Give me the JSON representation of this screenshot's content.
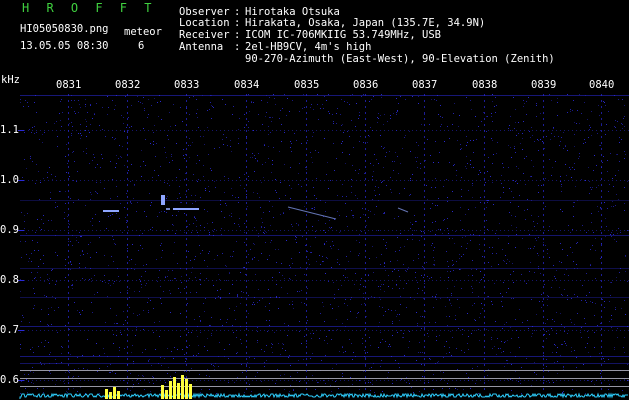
{
  "header": {
    "app_title": "H R O F F T",
    "file_name": "HI05050830.png",
    "mode_label": "meteor",
    "datetime": "13.05.05 08:30",
    "count": "6",
    "observer_label": "Observer",
    "observer": "Hirotaka Otsuka",
    "location_label": "Location",
    "location": "Hirakata, Osaka, Japan (135.7E, 34.9N)",
    "receiver_label": "Receiver",
    "receiver": "ICOM IC-706MKIIG 53.749MHz, USB",
    "antenna_label": "Antenna",
    "antenna": "2el-HB9CV, 4m's high",
    "antenna_line2": "90-270-Azimuth (East-West), 90-Elevation (Zenith)"
  },
  "axes": {
    "y_unit": "kHz",
    "x_ticks": [
      "0831",
      "0832",
      "0833",
      "0834",
      "0835",
      "0836",
      "0837",
      "0838",
      "0839",
      "0840"
    ],
    "y_ticks": [
      "1.1",
      "1.0",
      "0.9",
      "0.8",
      "0.7",
      "0.6"
    ]
  },
  "colors": {
    "background": "#000000",
    "title_green": "#3fd03f",
    "noise_blue": "#2a2ad8",
    "echo_blue": "#8fa6ff",
    "baseline_cyan": "#2ed0ff",
    "spike_yellow": "#ffff40",
    "ref_line": "#b0b0c0"
  }
}
